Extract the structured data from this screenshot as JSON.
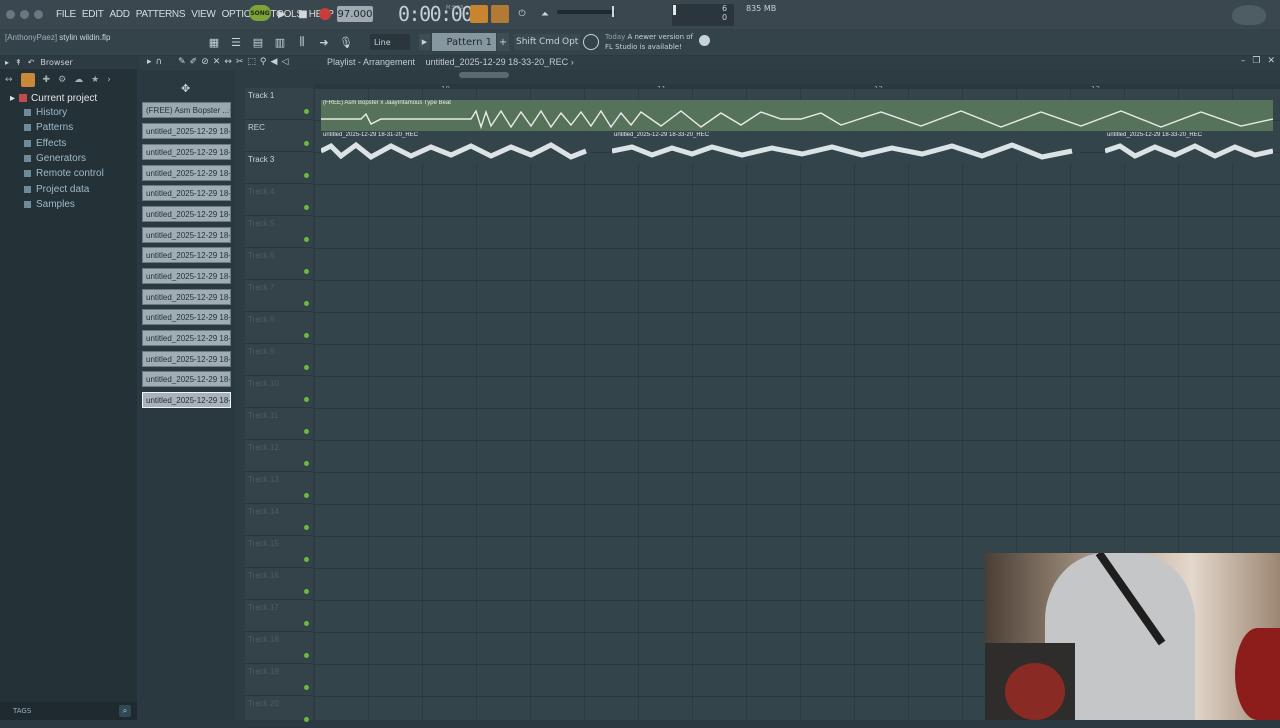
{
  "menu": [
    "FILE",
    "EDIT",
    "ADD",
    "PATTERNS",
    "VIEW",
    "OPTIONS",
    "TOOLS",
    "HELP"
  ],
  "transport": {
    "song_toggle": "SONG",
    "tempo": "97.000",
    "time": "0:00:00",
    "time_unit": "M:S:CS",
    "cpu_value": "6",
    "cpu_zero": "0",
    "memory": "835 MB"
  },
  "project": {
    "user": "[AnthonyPaez]",
    "file": "stylin wildin.flp"
  },
  "toolbar2": {
    "snap": "Line",
    "pattern": "Pattern 1",
    "pattern_add": "+",
    "shift": "Shift",
    "cmd": "Cmd",
    "opt": "Opt",
    "news_today": "Today",
    "news_line1": "A newer version of",
    "news_line2": "FL Studio is available!"
  },
  "browser": {
    "title": "Browser",
    "root": "Current project",
    "items": [
      "History",
      "Patterns",
      "Effects",
      "Generators",
      "Remote control",
      "Project data",
      "Samples"
    ],
    "tags": "TAGS"
  },
  "playlist": {
    "title_prefix": "Playlist - Arrangement",
    "title_clip": "untitled_2025-12-29 18-33-20_REC",
    "bar_numbers": [
      "10",
      "11",
      "12",
      "13"
    ],
    "patterns": [
      "(FREE) Asm Bopster ...",
      "untitled_2025-12-29 18-...",
      "untitled_2025-12-29 18-...",
      "untitled_2025-12-29 18-...",
      "untitled_2025-12-29 18-...",
      "untitled_2025-12-29 18-...",
      "untitled_2025-12-29 18-...",
      "untitled_2025-12-29 18-...",
      "untitled_2025-12-29 18-...",
      "untitled_2025-12-29 18-...",
      "untitled_2025-12-29 18-...",
      "untitled_2025-12-29 18-...",
      "untitled_2025-12-29 18-...",
      "untitled_2025-12-29 18-...",
      "untitled_2025-12-29 18-..."
    ],
    "tracks": [
      "Track 1",
      "REC",
      "Track 3",
      "Track 4",
      "Track 5",
      "Track 6",
      "Track 7",
      "Track 8",
      "Track 9",
      "Track 10",
      "Track 11",
      "Track 12",
      "Track 13",
      "Track 14",
      "Track 15",
      "Track 16",
      "Track 17",
      "Track 18",
      "Track 19",
      "Track 20"
    ],
    "clips": {
      "beat": "(FREE) Asm Bopster x JaayInfamous Type Beat",
      "rec_a": "untitled_2025-12-29 18-31-20_REC",
      "rec_b": "untitled_2025-12-29 18-33-20_REC",
      "rec_c": "untitled_2025-12-29 18-33-20_REC"
    }
  },
  "colors": {
    "accent_green": "#7ea33a",
    "accent_orange": "#c7852f",
    "record_red": "#c83c3c",
    "beat_clip": "#57725a"
  }
}
